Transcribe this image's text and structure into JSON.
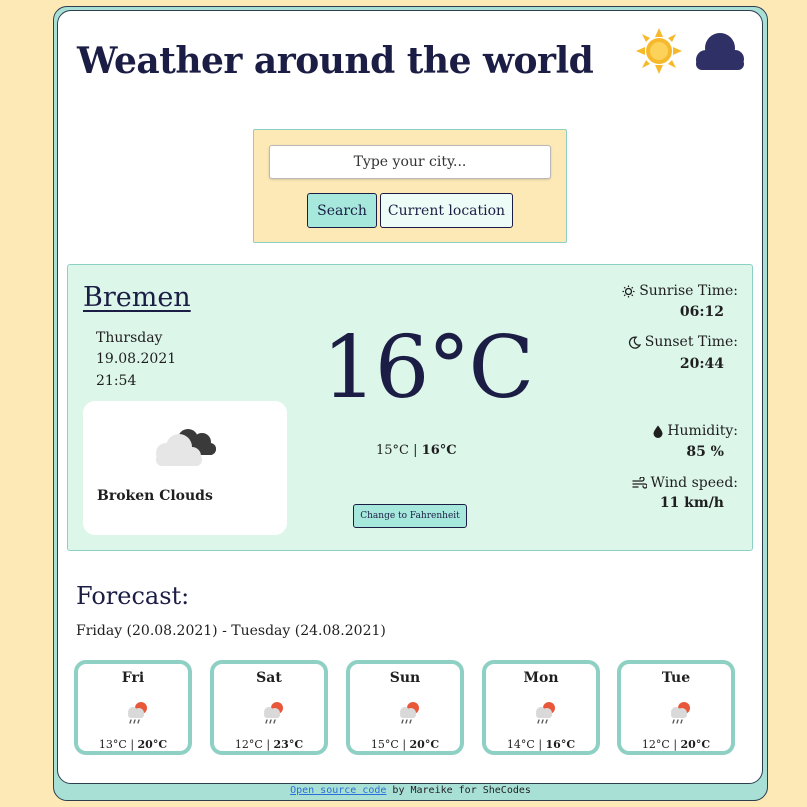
{
  "header": {
    "title": "Weather around the world",
    "icons": [
      "sun-icon",
      "cloud-icon"
    ],
    "sun_color": "#f6b92b",
    "cloud_color": "#2e3066"
  },
  "search": {
    "placeholder": "Type your city...",
    "search_label": "Search",
    "current_location_label": "Current location"
  },
  "current": {
    "city": "Bremen",
    "day": "Thursday",
    "date": "19.08.2021",
    "time": "21:54",
    "condition": "Broken Clouds",
    "condition_icon": "broken-clouds-icon",
    "temperature": "16",
    "unit": "°C",
    "min": "15°C",
    "max": "16°C",
    "separator": " | ",
    "fahrenheit_button": "Change to Fahrenheit",
    "sunrise_label": "Sunrise Time:",
    "sunrise_value": "06:12",
    "sunset_label": "Sunset Time:",
    "sunset_value": "20:44",
    "humidity_label": "Humidity:",
    "humidity_value": "85 %",
    "wind_label": "Wind speed:",
    "wind_value": "11 km/h"
  },
  "forecast": {
    "title": "Forecast:",
    "range": "Friday (20.08.2021) - Tuesday (24.08.2021)",
    "days": [
      {
        "day": "Fri",
        "min": "13°C",
        "max": "20°C",
        "icon": "rain-cloud-icon"
      },
      {
        "day": "Sat",
        "min": "12°C",
        "max": "23°C",
        "icon": "rain-cloud-icon"
      },
      {
        "day": "Sun",
        "min": "15°C",
        "max": "20°C",
        "icon": "rain-cloud-icon"
      },
      {
        "day": "Mon",
        "min": "14°C",
        "max": "16°C",
        "icon": "rain-cloud-icon"
      },
      {
        "day": "Tue",
        "min": "12°C",
        "max": "20°C",
        "icon": "rain-cloud-icon"
      }
    ]
  },
  "footer": {
    "link_text": "Open source code",
    "rest_text": " by Mareike for SheCodes"
  },
  "colors": {
    "page_bg": "#fde9b6",
    "accent": "#a6e9dc",
    "panel": "#dcf6ea",
    "border": "#8ed0c3",
    "text_dark": "#1b1d44"
  }
}
